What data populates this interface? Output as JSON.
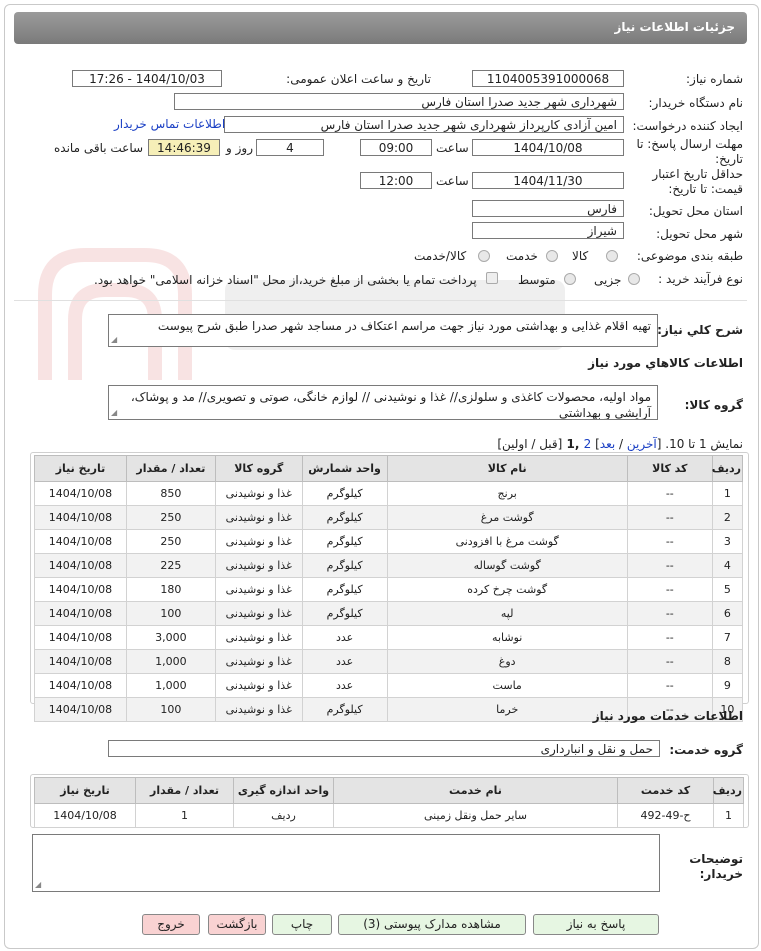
{
  "header": {
    "title": "جزئیات اطلاعات نیاز"
  },
  "form": {
    "need_number_label": "شماره نیاز:",
    "need_number": "1104005391000068",
    "announce_label": "تاریخ و ساعت اعلان عمومی:",
    "announce_value": "1404/10/03 - 17:26",
    "buyer_label": "نام دستگاه خریدار:",
    "buyer_value": "شهرداری شهر جدید صدرا استان فارس",
    "creator_label": "ایجاد کننده درخواست:",
    "creator_value": "امین آزادی کارپرداز شهرداری شهر جدید صدرا استان فارس",
    "contact_link": "اطلاعات تماس خریدار",
    "deadline_label_1": "مهلت ارسال پاسخ: تا",
    "deadline_label_2": "تاریخ:",
    "deadline_date": "1404/10/08",
    "time_label": "ساعت",
    "deadline_time": "09:00",
    "days_value": "4",
    "days_label": "روز و",
    "remaining_time": "14:46:39",
    "remaining_label": "ساعت باقی مانده",
    "validity_label_1": "حداقل تاریخ اعتبار",
    "validity_label_2": "قیمت: تا تاریخ:",
    "validity_date": "1404/11/30",
    "validity_time_label": "ساعت",
    "validity_time": "12:00",
    "province_label": "استان محل تحویل:",
    "province_value": "فارس",
    "city_label": "شهر محل تحویل:",
    "city_value": "شیراز",
    "category_label": "طبقه بندی موضوعی:",
    "category_options": [
      "کالا",
      "خدمت",
      "کالا/خدمت"
    ],
    "purchase_label": "نوع فرآیند خرید :",
    "purchase_options": [
      "جزیی",
      "متوسط"
    ],
    "payment_note": "پرداخت تمام یا بخشی از مبلغ خرید،از محل \"اسناد خزانه اسلامی\" خواهد بود."
  },
  "summary": {
    "label": "شرح کلي نياز:",
    "value": "تهیه اقلام غذایی و بهداشتی مورد نیاز جهت مراسم اعتکاف در مساجد شهر صدرا طبق شرح پیوست"
  },
  "goods": {
    "section_title": "اطلاعات کالاهاي مورد نياز",
    "group_label": "گروه کالا:",
    "group_value": "مواد اولیه، محصولات کاغذی و سلولزی// غذا و نوشیدنی // لوازم خانگی، صوتی و تصویری// مد و پوشاک، آرایشی و بهداشتی",
    "pager": {
      "prefix": "نمایش 1 تا 10. [",
      "last": "آخرین",
      "slash1": " / ",
      "next": "بعد",
      "slash2": "] ",
      "page2": "2",
      "page1": " ,1 ",
      "suffix": "[قبل / اولین]"
    },
    "columns": [
      "ردیف",
      "کد کالا",
      "نام کالا",
      "واحد شمارش",
      "گروه کالا",
      "تعداد / مقدار",
      "تاریخ نیاز"
    ],
    "rows": [
      [
        "1",
        "--",
        "برنج",
        "کیلوگرم",
        "غذا و نوشیدنی",
        "850",
        "1404/10/08"
      ],
      [
        "2",
        "--",
        "گوشت مرغ",
        "کیلوگرم",
        "غذا و نوشیدنی",
        "250",
        "1404/10/08"
      ],
      [
        "3",
        "--",
        "گوشت مرغ با افزودنی",
        "کیلوگرم",
        "غذا و نوشیدنی",
        "250",
        "1404/10/08"
      ],
      [
        "4",
        "--",
        "گوشت گوساله",
        "کیلوگرم",
        "غذا و نوشیدنی",
        "225",
        "1404/10/08"
      ],
      [
        "5",
        "--",
        "گوشت چرخ کرده",
        "کیلوگرم",
        "غذا و نوشیدنی",
        "180",
        "1404/10/08"
      ],
      [
        "6",
        "--",
        "لپه",
        "کیلوگرم",
        "غذا و نوشیدنی",
        "100",
        "1404/10/08"
      ],
      [
        "7",
        "--",
        "نوشابه",
        "عدد",
        "غذا و نوشیدنی",
        "3,000",
        "1404/10/08"
      ],
      [
        "8",
        "--",
        "دوغ",
        "عدد",
        "غذا و نوشیدنی",
        "1,000",
        "1404/10/08"
      ],
      [
        "9",
        "--",
        "ماست",
        "عدد",
        "غذا و نوشیدنی",
        "1,000",
        "1404/10/08"
      ],
      [
        "10",
        "--",
        "خرما",
        "کیلوگرم",
        "غذا و نوشیدنی",
        "100",
        "1404/10/08"
      ]
    ]
  },
  "services": {
    "section_title": "اطلاعات خدمات مورد نياز",
    "group_label": "گروه خدمت:",
    "group_value": "حمل و نقل و انبارداری",
    "columns": [
      "ردیف",
      "کد خدمت",
      "نام خدمت",
      "واحد اندازه گیری",
      "تعداد / مقدار",
      "تاریخ نیاز"
    ],
    "rows": [
      [
        "1",
        "ح-49-492",
        "سایر حمل ونقل زمینی",
        "ردیف",
        "1",
        "1404/10/08"
      ]
    ]
  },
  "notes": {
    "label_1": "توضیحات",
    "label_2": "خریدار:",
    "value": ""
  },
  "buttons": {
    "reply": "پاسخ به نیاز",
    "attachments": "مشاهده مدارک پیوستی (3)",
    "print": "چاپ",
    "back": "بازگشت",
    "exit": "خروج"
  },
  "colors": {
    "title_bar": "#8a8a8a",
    "link": "#1a3fc4",
    "highlight": "#f6efb8",
    "reply_button": "#e6f6e2",
    "exit_button": "#f9d2d2"
  }
}
